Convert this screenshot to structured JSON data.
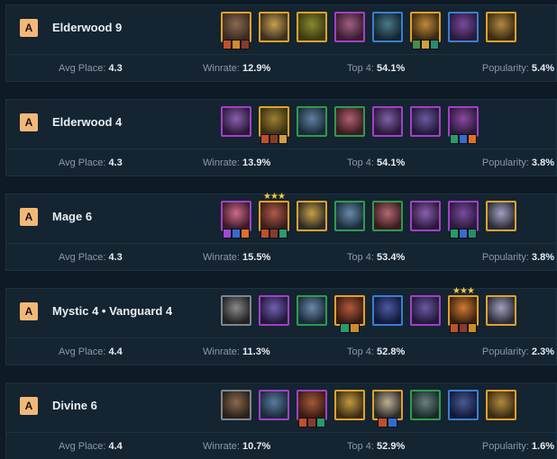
{
  "labels": {
    "avg_place": "Avg Place:",
    "winrate": "Winrate:",
    "top4": "Top 4:",
    "popularity": "Popularity:"
  },
  "tier_colors": {
    "A": "#f2b87a"
  },
  "cost_colors": [
    "#7d8790",
    "#2f9b4a",
    "#3a7fd0",
    "#a340c8",
    "#e0a22a"
  ],
  "comps": [
    {
      "tier": "A",
      "name": "Elderwood 9",
      "avg_place": "4.3",
      "winrate": "12.9%",
      "top4": "54.1%",
      "popularity": "5.4%",
      "champions": [
        {
          "icon": "champion-portrait",
          "cost": 5,
          "stars": "",
          "items": [
            "sword-item",
            "crossbow-item",
            "rageblade-item"
          ],
          "palette": [
            "#3c2a22",
            "#8a6a50"
          ]
        },
        {
          "icon": "champion-portrait",
          "cost": 5,
          "stars": "",
          "items": [],
          "palette": [
            "#3a3020",
            "#c8a050"
          ]
        },
        {
          "icon": "champion-portrait",
          "cost": 5,
          "stars": "",
          "items": [],
          "palette": [
            "#3a3a12",
            "#8a8a2a"
          ]
        },
        {
          "icon": "champion-portrait",
          "cost": 4,
          "stars": "",
          "items": [],
          "palette": [
            "#3a1a2e",
            "#a06080"
          ]
        },
        {
          "icon": "champion-portrait",
          "cost": 3,
          "stars": "",
          "items": [],
          "palette": [
            "#12252e",
            "#4a7a8a"
          ]
        },
        {
          "icon": "champion-portrait",
          "cost": 5,
          "stars": "",
          "items": [
            "claw-item",
            "bow-item",
            "tear-item"
          ],
          "palette": [
            "#3a2812",
            "#c08a3a"
          ]
        },
        {
          "icon": "champion-portrait",
          "cost": 3,
          "stars": "",
          "items": [],
          "palette": [
            "#2a1a3a",
            "#7a4aa0"
          ]
        },
        {
          "icon": "champion-portrait",
          "cost": 5,
          "stars": "",
          "items": [],
          "palette": [
            "#3a2a12",
            "#b08a40"
          ]
        }
      ]
    },
    {
      "tier": "A",
      "name": "Elderwood 4",
      "avg_place": "4.3",
      "winrate": "13.9%",
      "top4": "54.1%",
      "popularity": "3.8%",
      "champions": [
        {
          "icon": "champion-portrait",
          "cost": 4,
          "stars": "",
          "items": [],
          "palette": [
            "#2a1838",
            "#8a60b0"
          ]
        },
        {
          "icon": "champion-portrait",
          "cost": 5,
          "stars": "",
          "items": [
            "sword-item",
            "rageblade-item",
            "bow-item"
          ],
          "palette": [
            "#3a3012",
            "#9a8030"
          ]
        },
        {
          "icon": "champion-portrait",
          "cost": 2,
          "stars": "",
          "items": [],
          "palette": [
            "#1a2a3a",
            "#6080a0"
          ]
        },
        {
          "icon": "champion-portrait",
          "cost": 2,
          "stars": "",
          "items": [],
          "palette": [
            "#3a1a20",
            "#b06070"
          ]
        },
        {
          "icon": "champion-portrait",
          "cost": 4,
          "stars": "",
          "items": [],
          "palette": [
            "#2a1838",
            "#8060a8"
          ]
        },
        {
          "icon": "champion-portrait",
          "cost": 4,
          "stars": "",
          "items": [],
          "palette": [
            "#221838",
            "#6a5aa0"
          ]
        },
        {
          "icon": "champion-portrait",
          "cost": 4,
          "stars": "",
          "items": [
            "cloak-item",
            "crystal-item",
            "flame-item"
          ],
          "palette": [
            "#2a1a3a",
            "#8a4aa0"
          ]
        }
      ]
    },
    {
      "tier": "A",
      "name": "Mage 6",
      "avg_place": "4.3",
      "winrate": "15.5%",
      "top4": "53.4%",
      "popularity": "3.8%",
      "champions": [
        {
          "icon": "champion-portrait",
          "cost": 4,
          "stars": "",
          "items": [
            "staff-item",
            "crystal-item",
            "flame-item"
          ],
          "palette": [
            "#3a1a28",
            "#d06a8a"
          ]
        },
        {
          "icon": "champion-portrait",
          "cost": 5,
          "stars": "★★★",
          "items": [
            "sword-item",
            "rageblade-item",
            "cloak-item"
          ],
          "palette": [
            "#3a1e1a",
            "#b05a4a"
          ]
        },
        {
          "icon": "champion-portrait",
          "cost": 5,
          "stars": "",
          "items": [],
          "palette": [
            "#2a2a2a",
            "#c8a040"
          ]
        },
        {
          "icon": "champion-portrait",
          "cost": 2,
          "stars": "",
          "items": [],
          "palette": [
            "#1a2a3a",
            "#6a8aa8"
          ]
        },
        {
          "icon": "champion-portrait",
          "cost": 2,
          "stars": "",
          "items": [],
          "palette": [
            "#3a1a1e",
            "#b06a70"
          ]
        },
        {
          "icon": "champion-portrait",
          "cost": 4,
          "stars": "",
          "items": [],
          "palette": [
            "#2a1838",
            "#8a60b0"
          ]
        },
        {
          "icon": "champion-portrait",
          "cost": 4,
          "stars": "",
          "items": [
            "cloak-item",
            "crystal-item",
            "tear-item"
          ],
          "palette": [
            "#2a1a3a",
            "#7a4aa0"
          ]
        },
        {
          "icon": "champion-portrait",
          "cost": 5,
          "stars": "",
          "items": [],
          "palette": [
            "#2a2a38",
            "#a0a0c0"
          ]
        }
      ]
    },
    {
      "tier": "A",
      "name": "Mystic 4 • Vanguard 4",
      "avg_place": "4.4",
      "winrate": "11.3%",
      "top4": "52.8%",
      "popularity": "2.3%",
      "champions": [
        {
          "icon": "champion-portrait",
          "cost": 1,
          "stars": "",
          "items": [],
          "palette": [
            "#222222",
            "#8a8a8a"
          ]
        },
        {
          "icon": "champion-portrait",
          "cost": 4,
          "stars": "",
          "items": [],
          "palette": [
            "#22183a",
            "#7060b0"
          ]
        },
        {
          "icon": "champion-portrait",
          "cost": 2,
          "stars": "",
          "items": [],
          "palette": [
            "#1a2a3a",
            "#6a8aa8"
          ]
        },
        {
          "icon": "champion-portrait",
          "cost": 5,
          "stars": "",
          "items": [
            "cloak-item",
            "crossbow-item"
          ],
          "palette": [
            "#3a1a12",
            "#b05a3a"
          ]
        },
        {
          "icon": "champion-portrait",
          "cost": 3,
          "stars": "",
          "items": [],
          "palette": [
            "#12183a",
            "#4a5aa0"
          ]
        },
        {
          "icon": "champion-portrait",
          "cost": 4,
          "stars": "",
          "items": [],
          "palette": [
            "#22183a",
            "#6a5aa0"
          ]
        },
        {
          "icon": "champion-portrait",
          "cost": 5,
          "stars": "★★★",
          "items": [
            "sword-item",
            "rageblade-item",
            "crossbow-item"
          ],
          "palette": [
            "#3a2010",
            "#d07a30"
          ]
        },
        {
          "icon": "champion-portrait",
          "cost": 5,
          "stars": "",
          "items": [],
          "palette": [
            "#2a2a38",
            "#a0a0c0"
          ]
        }
      ]
    },
    {
      "tier": "A",
      "name": "Divine 6",
      "avg_place": "4.4",
      "winrate": "10.7%",
      "top4": "52.9%",
      "popularity": "1.6%",
      "champions": [
        {
          "icon": "champion-portrait",
          "cost": 1,
          "stars": "",
          "items": [],
          "palette": [
            "#2a2018",
            "#8a6a50"
          ]
        },
        {
          "icon": "champion-portrait",
          "cost": 4,
          "stars": "",
          "items": [],
          "palette": [
            "#1a2a3a",
            "#5a7aa0"
          ]
        },
        {
          "icon": "champion-portrait",
          "cost": 4,
          "stars": "",
          "items": [
            "sword-item",
            "rageblade-item",
            "cloak-item"
          ],
          "palette": [
            "#3a1a12",
            "#a05a3a"
          ]
        },
        {
          "icon": "champion-portrait",
          "cost": 5,
          "stars": "",
          "items": [],
          "palette": [
            "#3a2a12",
            "#c09a40"
          ]
        },
        {
          "icon": "champion-portrait",
          "cost": 5,
          "stars": "",
          "items": [
            "sword-item",
            "crystal-item"
          ],
          "palette": [
            "#2a2a2a",
            "#c0b090"
          ]
        },
        {
          "icon": "champion-portrait",
          "cost": 2,
          "stars": "",
          "items": [],
          "palette": [
            "#1a2a2a",
            "#6a8080"
          ]
        },
        {
          "icon": "champion-portrait",
          "cost": 3,
          "stars": "",
          "items": [],
          "palette": [
            "#12183a",
            "#4a5a90"
          ]
        },
        {
          "icon": "champion-portrait",
          "cost": 5,
          "stars": "",
          "items": [],
          "palette": [
            "#3a2a12",
            "#b08a40"
          ]
        }
      ]
    }
  ],
  "item_colors": {
    "sword-item": "#c0502a",
    "crossbow-item": "#d08a2a",
    "rageblade-item": "#8a3a2a",
    "claw-item": "#4a8a4a",
    "bow-item": "#d0a03a",
    "tear-item": "#2a8a6a",
    "cloak-item": "#2a9a6a",
    "crystal-item": "#3a6ad0",
    "flame-item": "#e0702a",
    "staff-item": "#a04ad0"
  }
}
